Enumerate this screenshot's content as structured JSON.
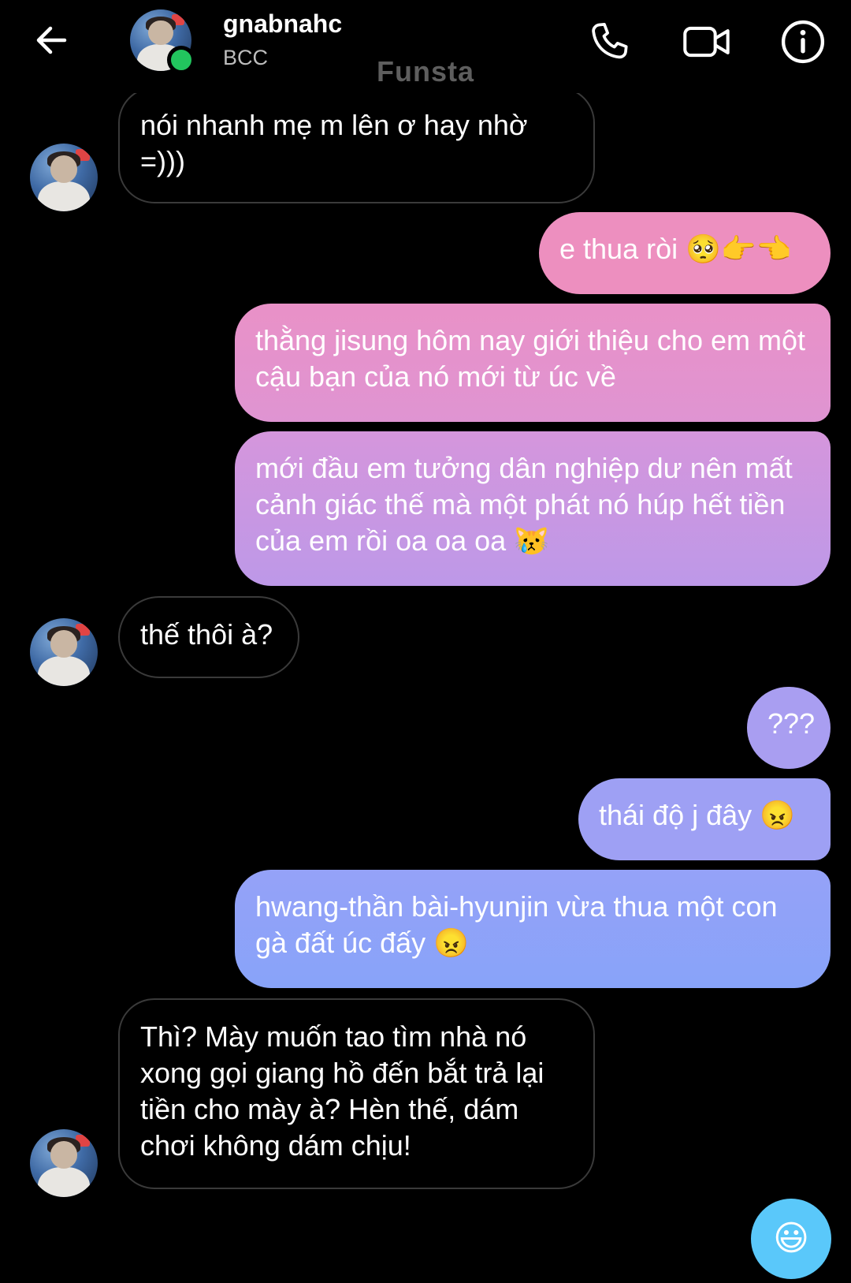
{
  "header": {
    "contact_name": "gnabnahc",
    "contact_subtitle": "BCC",
    "watermark": "Funsta",
    "icons": {
      "back": "arrow-left-icon",
      "call": "phone-icon",
      "video": "video-camera-icon",
      "info": "info-icon"
    },
    "online_color": "#22c55e"
  },
  "messages": [
    {
      "from": "them",
      "text": "nói nhanh mẹ m lên ơ hay nhờ =)))"
    },
    {
      "from": "me",
      "text": "e thua ròi 🥺👉👈"
    },
    {
      "from": "me",
      "text": "thằng jisung hôm nay giới thiệu cho em một cậu bạn của nó mới từ úc về"
    },
    {
      "from": "me",
      "text": "mới đầu em tưởng dân nghiệp dư nên mất cảnh giác thế mà một phát nó húp hết tiền của em rồi oa oa oa 😿"
    },
    {
      "from": "them",
      "text": "thế thôi à?"
    },
    {
      "from": "me",
      "text": "???"
    },
    {
      "from": "me",
      "text": "thái độ j đây 😠"
    },
    {
      "from": "me",
      "text": "hwang-thần bài-hyunjin vừa thua một con gà đất úc đấy 😠"
    },
    {
      "from": "them",
      "text": "Thì? Mày muốn tao tìm nhà nó xong gọi giang hồ đến bắt trả lại tiền cho mày à? Hèn thế, dám chơi không dám chịu!"
    }
  ],
  "composer": {
    "emoji_button": "😃",
    "emoji_icon": "smiley-icon",
    "button_color": "#5ac8fa"
  },
  "colors": {
    "bubble_gradient_top": "#ee8fc0",
    "bubble_gradient_bottom": "#8a9ef8",
    "incoming_border": "#3a3a3a"
  }
}
